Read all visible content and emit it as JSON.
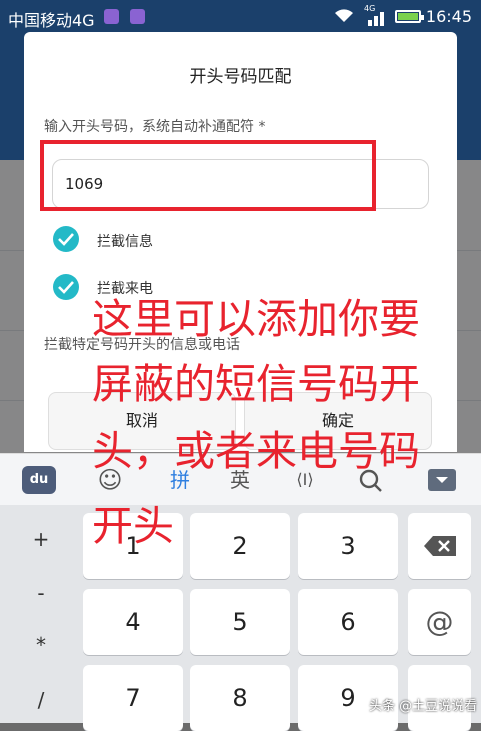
{
  "status_bar": {
    "carrier": "中国移动4G",
    "network_badge": "4G",
    "time": "16:45"
  },
  "dialog": {
    "title": "开头号码匹配",
    "hint": "输入开头号码，系统自动补通配符 *",
    "input_value": "1069",
    "options": [
      {
        "label": "拦截信息",
        "checked": true
      },
      {
        "label": "拦截来电",
        "checked": true
      }
    ],
    "description": "拦截特定号码开头的信息或电话",
    "cancel_label": "取消",
    "confirm_label": "确定"
  },
  "keyboard": {
    "toolbar": {
      "logo_label": "du",
      "emoji": "☺",
      "pinyin_label": "拼",
      "english_label": "英",
      "cursor_label": "⟨I⟩",
      "search_icon": "search-icon",
      "hide_icon": "hide-keyboard-icon"
    },
    "side_keys": [
      "+",
      "-",
      "*",
      "/"
    ],
    "number_rows": [
      [
        "1",
        "2",
        "3"
      ],
      [
        "4",
        "5",
        "6"
      ],
      [
        "7",
        "8",
        "9"
      ]
    ],
    "right_keys": [
      "delete-icon",
      "@",
      ""
    ]
  },
  "annotation": {
    "lines": [
      "这里可以添加你要",
      "屏蔽的短信号码开",
      "头，或者来电号码",
      "开头"
    ]
  },
  "watermark": "头条 @土豆说说看",
  "colors": {
    "accent": "#23b9c7",
    "highlight_red": "#e8232e",
    "header_blue": "#2f6fb8"
  }
}
